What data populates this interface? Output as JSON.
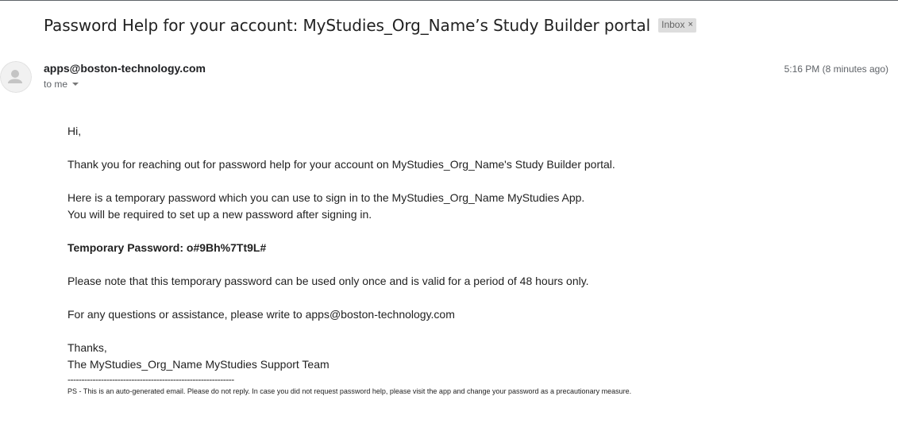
{
  "email": {
    "subject": "Password Help for your account: MyStudies_Org_Name’s Study Builder portal",
    "label": "Inbox",
    "label_close": "×",
    "sender": "apps@boston-technology.com",
    "recipient": "to me",
    "timestamp": "5:16 PM (8 minutes ago)",
    "body": {
      "greeting": "Hi,",
      "p1": "Thank you for reaching out for password help for your account on MyStudies_Org_Name's Study Builder portal.",
      "p2_line1": "Here is a temporary password which you can use to sign in to the MyStudies_Org_Name MyStudies App.",
      "p2_line2": "You will be required to set up a new password after signing in.",
      "temp_password": "Temporary Password: o#9Bh%7Tt9L#",
      "p3": "Please note that this temporary password can be used only once and is valid for a period of 48 hours only.",
      "p4": "For any questions or assistance, please write to apps@boston-technology.com",
      "closing": "Thanks,",
      "signature": "The MyStudies_Org_Name MyStudies Support Team",
      "divider": "------------------------------------------------------------",
      "ps": "PS - This is an auto-generated email. Please do not reply. In case you did not request password help, please visit the app and change your password as a precautionary measure."
    }
  },
  "icons": {
    "avatar": "person-avatar-icon",
    "recipient_caret": "caret-down-icon"
  }
}
